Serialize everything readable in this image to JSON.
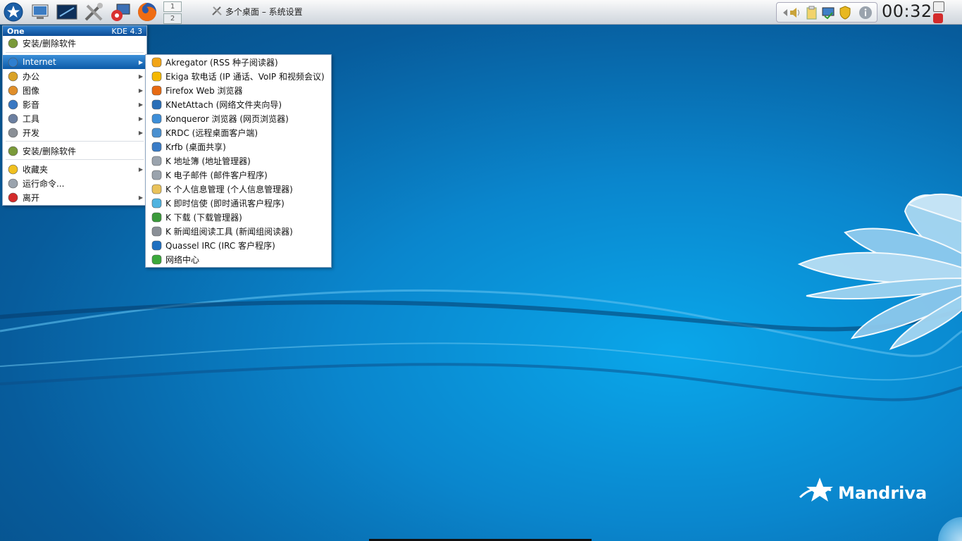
{
  "taskbar": {
    "launchers": [
      {
        "name": "kickoff-star-icon"
      },
      {
        "name": "desktop-icon"
      },
      {
        "name": "terminal-icon"
      },
      {
        "name": "system-tools-icon"
      },
      {
        "name": "remote-desktop-icon"
      },
      {
        "name": "firefox-icon"
      }
    ],
    "pager": [
      "1",
      "2"
    ],
    "window_task": "多个桌面 – 系统设置",
    "clock": "00:32"
  },
  "launcher": {
    "brand": "One",
    "version": "KDE 4.3",
    "items": [
      {
        "label": "安装/删除软件",
        "icon": "install-software-icon",
        "arrow": false
      },
      {
        "label": "Internet",
        "icon": "internet-globe-icon",
        "arrow": true,
        "active": true
      },
      {
        "label": "办公",
        "icon": "office-icon",
        "arrow": true
      },
      {
        "label": "图像",
        "icon": "graphics-icon",
        "arrow": true
      },
      {
        "label": "影音",
        "icon": "multimedia-icon",
        "arrow": true
      },
      {
        "label": "工具",
        "icon": "tools-icon",
        "arrow": true
      },
      {
        "label": "开发",
        "icon": "development-icon",
        "arrow": true
      },
      {
        "label": "安装/删除软件",
        "icon": "install-software-icon",
        "arrow": false
      },
      {
        "label": "收藏夹",
        "icon": "favorites-star-icon",
        "arrow": true
      },
      {
        "label": "运行命令...",
        "icon": "run-command-icon",
        "arrow": false
      },
      {
        "label": "离开",
        "icon": "leave-power-icon",
        "arrow": true
      }
    ]
  },
  "submenu": {
    "items": [
      {
        "label": "Akregator (RSS 种子阅读器)",
        "icon": "akregator-icon",
        "color": "#f2a516"
      },
      {
        "label": "Ekiga 软电话 (IP 通话、VoIP 和视频会议)",
        "icon": "ekiga-icon",
        "color": "#f5b800"
      },
      {
        "label": "Firefox Web 浏览器",
        "icon": "firefox-icon",
        "color": "#e76a12"
      },
      {
        "label": "KNetAttach (网络文件夹向导)",
        "icon": "knetattach-icon",
        "color": "#2a6fb8"
      },
      {
        "label": "Konqueror 浏览器 (网页浏览器)",
        "icon": "konqueror-icon",
        "color": "#3d8ed8"
      },
      {
        "label": "KRDC (远程桌面客户端)",
        "icon": "krdc-icon",
        "color": "#4a90d0"
      },
      {
        "label": "Krfb (桌面共享)",
        "icon": "krfb-icon",
        "color": "#3a7cc7"
      },
      {
        "label": "K 地址簿 (地址管理器)",
        "icon": "address-book-icon",
        "color": "#9aa3ad"
      },
      {
        "label": "K 电子邮件 (邮件客户程序)",
        "icon": "email-icon",
        "color": "#9aa3ad"
      },
      {
        "label": "K 个人信息管理 (个人信息管理器)",
        "icon": "pim-icon",
        "color": "#e9c25a"
      },
      {
        "label": "K 即时信使 (即时通讯客户程序)",
        "icon": "messenger-icon",
        "color": "#4fb3e0"
      },
      {
        "label": "K 下载 (下载管理器)",
        "icon": "download-icon",
        "color": "#3a9a3a"
      },
      {
        "label": "K 新闻组阅读工具 (新闻组阅读器)",
        "icon": "news-reader-icon",
        "color": "#8a8f96"
      },
      {
        "label": "Quassel IRC (IRC 客户程序)",
        "icon": "quassel-icon",
        "color": "#1e6fc0"
      },
      {
        "label": "网络中心",
        "icon": "network-center-icon",
        "color": "#3aa83a"
      }
    ]
  },
  "desktop": {
    "brand": "Mandriva"
  }
}
